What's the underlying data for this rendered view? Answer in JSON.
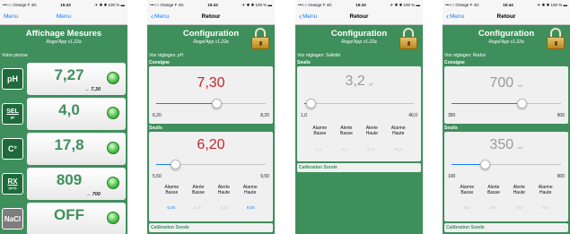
{
  "status": {
    "carrier": "•••○○ Orange F  4G",
    "battery": "✈ ✱ ✱ 100 % ▬",
    "times": [
      "15:43",
      "15:43",
      "15:43",
      "15:44"
    ]
  },
  "screens": [
    {
      "nav_left": "Menu",
      "nav_title": "Menu",
      "header_title": "Affichage Mesures",
      "header_sub": "Regul'App v1.22a",
      "section_label": "Votre piscine",
      "measures": [
        {
          "icon": "pH",
          "icon_name": "ph-icon",
          "value": "7,27",
          "setpoint": "→ 7,30"
        },
        {
          "icon": "SEL",
          "icon_sub": "g/l",
          "icon_name": "salt-icon",
          "value": "4,0",
          "setpoint": ""
        },
        {
          "icon": "C°",
          "icon_name": "temperature-icon",
          "value": "17,8",
          "setpoint": ""
        },
        {
          "icon": "RX",
          "icon_sub": "(mV)",
          "icon_name": "redox-icon",
          "value": "809",
          "setpoint": "→ 700"
        },
        {
          "icon": "NaCl",
          "icon_name": "chlorinator-icon",
          "value": "OFF",
          "setpoint": ""
        }
      ]
    },
    {
      "nav_left": "Menu",
      "nav_title": "Retour",
      "header_title": "Configuration",
      "header_sub": "Regul'App v1.22a",
      "section_label": "Vos réglages: pH",
      "consigne_label": "Consigne",
      "consigne_value": "7,30",
      "consigne_min": "6,20",
      "consigne_max": "8,20",
      "consigne_fraction": 0.55,
      "seuils_label": "Seuils",
      "seuils_value": "6,20",
      "seuils_min": "5,50",
      "seuils_max": "9,50",
      "seuils_fraction": 0.18,
      "alarm_labels": [
        "Alarme\nBasse",
        "Alerte\nBasse",
        "Alerte\nHaute",
        "Alarme\nHaute"
      ],
      "alarm_values": [
        "6,00",
        "6,30",
        "8,30",
        "9,00"
      ],
      "calib_label": "Calibration Sonde"
    },
    {
      "nav_left": "Menu",
      "nav_title": "Retour",
      "header_title": "Configuration",
      "header_sub": "Regul'App v1.22a",
      "section_label": "Vos réglages: Salinité",
      "seuils_label": "Seuils",
      "seuils_value": "3,2",
      "seuils_unit": "g/l",
      "seuils_min": "1,0",
      "seuils_max": "40,0",
      "seuils_fraction": 0.06,
      "alarm_labels": [
        "Alarme\nBasse",
        "Alerte\nBasse",
        "Alerte\nHaute",
        "Alarme\nHaute"
      ],
      "alarm_values": [
        "2,4",
        "3,2",
        "33,0",
        "40,0"
      ],
      "calib_label": "Calibration Sonde"
    },
    {
      "nav_left": "Menu",
      "nav_title": "Retour",
      "header_title": "Configuration",
      "header_sub": "Regul'App v1.22a",
      "section_label": "Vos réglages: Redox",
      "consigne_label": "Consigne",
      "consigne_value": "700",
      "consigne_unit": "mV",
      "consigne_min": "350",
      "consigne_max": "900",
      "consigne_fraction": 0.64,
      "seuils_label": "Seuils",
      "seuils_value": "350",
      "seuils_unit": "mV",
      "seuils_min": "100",
      "seuils_max": "900",
      "seuils_fraction": 0.31,
      "alarm_labels": [
        "Alarme\nBasse",
        "Alerte\nBasse",
        "Alerte\nHaute",
        "Alarme\nHaute"
      ],
      "alarm_values": [
        "350",
        "350",
        "900",
        "900"
      ],
      "calib_label": "Calibration Sonde"
    }
  ],
  "colors": {
    "green": "#3f8f5c",
    "blue": "#1a7cf5",
    "red": "#c0262c",
    "grey": "#8a8a8a"
  }
}
